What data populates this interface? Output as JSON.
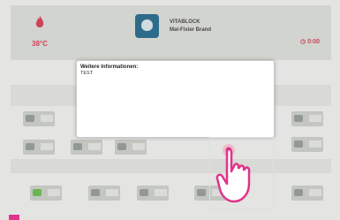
{
  "header": {
    "temperature": "38°C",
    "program_name": "VITABLOCK",
    "program_subtitle": "Mal-Fixier Brand",
    "timer": "0:00"
  },
  "dialog": {
    "title": "Weitere Informationen:",
    "body": "TEST"
  },
  "icons": {
    "flame": "flame-icon",
    "logo": "program-logo",
    "hand": "hand-pointer-icon",
    "timer": "clock-icon"
  },
  "colors": {
    "accent": "#d9445c",
    "logo_bg": "#2d6f92",
    "status_green": "#6fbf55",
    "brand_magenta": "#e0338b"
  }
}
